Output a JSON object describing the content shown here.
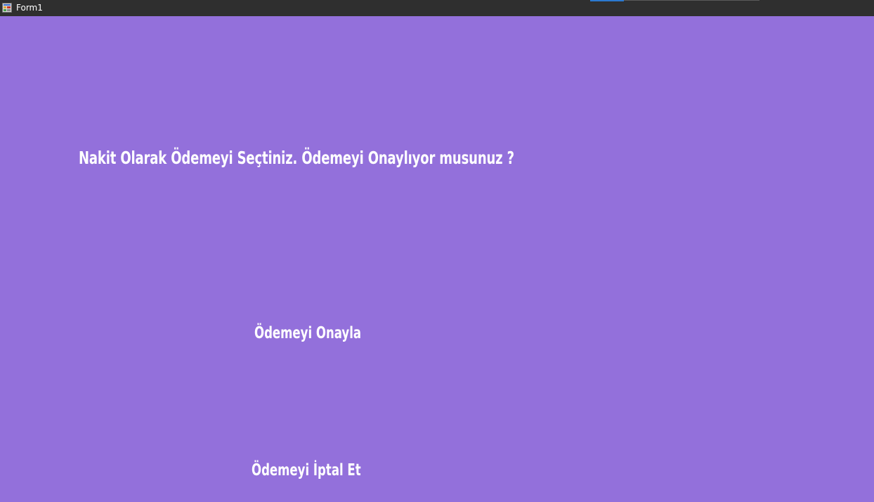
{
  "window": {
    "title": "Form1",
    "icon": "winforms-app-icon",
    "background_color": "#9370DB"
  },
  "form": {
    "question": "Nakit Olarak Ödemeyi Seçtiniz. Ödemeyi Onaylıyor musunuz ?",
    "confirm_label": "Ödemeyi Onayla",
    "cancel_label": "Ödemeyi İptal Et"
  }
}
